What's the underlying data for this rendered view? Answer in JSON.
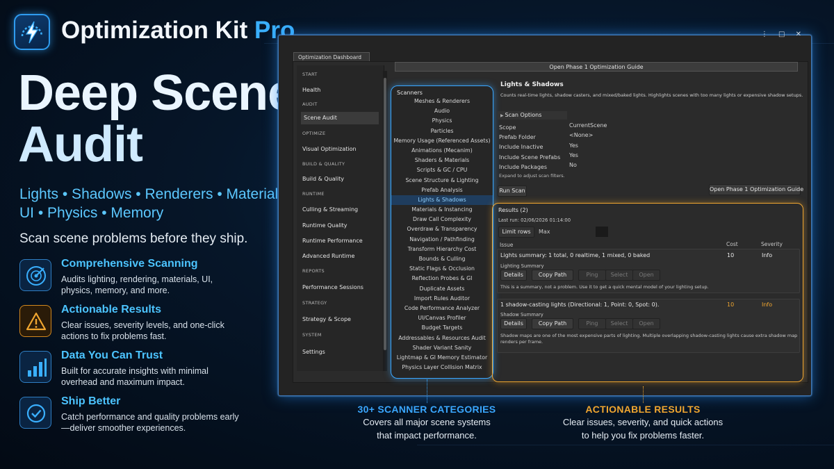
{
  "brand": {
    "name": "Optimization Kit ",
    "pro": "Pro",
    "icon": "lightning-bolt-icon",
    "accent": "#3ab0ff"
  },
  "headline": {
    "line1": "Deep Scene",
    "line2": "Audit"
  },
  "chips": {
    "row1": "Lights • Shadows • Renderers • Materials",
    "row2": "UI • Physics • Memory"
  },
  "tagline": "Scan scene problems before they ship.",
  "features": [
    {
      "icon": "radar-scan-icon",
      "title": "Comprehensive Scanning",
      "desc": "Audits lighting, rendering, materials, UI, physics, memory, and more."
    },
    {
      "icon": "warning-triangle-icon",
      "title": "Actionable Results",
      "desc": "Clear issues, severity levels, and one-click actions to fix problems fast."
    },
    {
      "icon": "bar-chart-icon",
      "title": "Data You Can Trust",
      "desc": "Built for accurate insights with minimal overhead and maximum impact."
    },
    {
      "icon": "check-circle-icon",
      "title": "Ship Better",
      "desc": "Catch performance and quality problems early—deliver smoother experiences."
    }
  ],
  "window": {
    "controls": "⋮ □ ✕",
    "tab": "Optimization Dashboard",
    "guide_bar": "Open Phase 1 Optimization Guide",
    "sidebar": [
      {
        "type": "section",
        "label": "START"
      },
      {
        "type": "item",
        "label": "Health"
      },
      {
        "type": "section",
        "label": "AUDIT"
      },
      {
        "type": "item",
        "label": "Scene Audit",
        "selected": true
      },
      {
        "type": "section",
        "label": "OPTIMIZE"
      },
      {
        "type": "item",
        "label": "Visual Optimization"
      },
      {
        "type": "section",
        "label": "BUILD & QUALITY"
      },
      {
        "type": "item",
        "label": "Build & Quality"
      },
      {
        "type": "section",
        "label": "RUNTIME"
      },
      {
        "type": "item",
        "label": "Culling & Streaming"
      },
      {
        "type": "item",
        "label": "Runtime Quality"
      },
      {
        "type": "item",
        "label": "Runtime Performance"
      },
      {
        "type": "item",
        "label": "Advanced Runtime"
      },
      {
        "type": "section",
        "label": "REPORTS"
      },
      {
        "type": "item",
        "label": "Performance Sessions"
      },
      {
        "type": "section",
        "label": "STRATEGY"
      },
      {
        "type": "item",
        "label": "Strategy & Scope"
      },
      {
        "type": "section",
        "label": "SYSTEM"
      },
      {
        "type": "item",
        "label": "Settings"
      }
    ],
    "scanners": {
      "title": "Scanners",
      "items": [
        "Meshes & Renderers",
        "Audio",
        "Physics",
        "Particles",
        "Memory Usage (Referenced Assets)",
        "Animations (Mecanim)",
        "Shaders & Materials",
        "Scripts & GC / CPU",
        "Scene Structure & Lighting",
        "Prefab Analysis",
        "Lights & Shadows",
        "Materials & Instancing",
        "Draw Call Complexity",
        "Overdraw & Transparency",
        "Navigation / Pathfinding",
        "Transform Hierarchy Cost",
        "Bounds & Culling",
        "Static Flags & Occlusion",
        "Reflection Probes & GI",
        "Duplicate Assets",
        "Import Rules Auditor",
        "Code Performance Analyzer",
        "UI/Canvas Profiler",
        "Budget Targets",
        "Addressables & Resources Audit",
        "Shader Variant Sanity",
        "Lightmap & GI Memory Estimator",
        "Physics Layer Collision Matrix"
      ],
      "selected": "Lights & Shadows"
    },
    "detail": {
      "title": "Lights & Shadows",
      "desc": "Counts real-time lights, shadow casters, and mixed/baked lights. Highlights scenes with too many lights or expensive shadow setups.",
      "options_label": "Scan Options",
      "options": [
        {
          "key": "Scope",
          "value": "CurrentScene"
        },
        {
          "key": "Prefab Folder",
          "value": "<None>"
        },
        {
          "key": "Include Inactive",
          "value": "Yes"
        },
        {
          "key": "Include Scene Prefabs",
          "value": "Yes"
        },
        {
          "key": "Include Packages",
          "value": "No"
        }
      ],
      "expand_note": "Expand to adjust scan filters.",
      "run_scan": "Run Scan",
      "guide_button": "Open Phase 1 Optimization Guide"
    },
    "results": {
      "title": "Results (2)",
      "last_run": "Last run: 02/06/2026 01:14:00",
      "limit_label": "Limit rows",
      "limit_value": "Max",
      "col_issue": "Issue",
      "col_cost": "Cost",
      "col_severity": "Severity",
      "actions": [
        "Details",
        "Copy Path",
        "Ping",
        "Select",
        "Open"
      ],
      "rows": [
        {
          "title": "Lights summary: 1 total, 0 realtime, 1 mixed, 0 baked",
          "category": "Lighting Summary",
          "cost": "10",
          "severity": "Info",
          "note": "This is a summary, not a problem. Use it to get a quick mental model of your lighting setup.",
          "highlight": false
        },
        {
          "title": "1 shadow-casting lights (Directional: 1, Point: 0, Spot: 0).",
          "category": "Shadow Summary",
          "cost": "10",
          "severity": "Info",
          "note": "Shadow maps are one of the most expensive parts of lighting. Multiple overlapping shadow-casting lights cause extra shadow map renders per frame.",
          "highlight": true
        }
      ]
    }
  },
  "callouts": {
    "scanners": {
      "title": "30+ SCANNER CATEGORIES",
      "desc1": "Covers all major scene systems",
      "desc2": "that impact performance.",
      "color": "#3aa7ff"
    },
    "results": {
      "title": "ACTIONABLE RESULTS",
      "desc1": "Clear issues, severity, and quick actions",
      "desc2": "to help you fix problems faster.",
      "color": "#f0a630"
    }
  }
}
